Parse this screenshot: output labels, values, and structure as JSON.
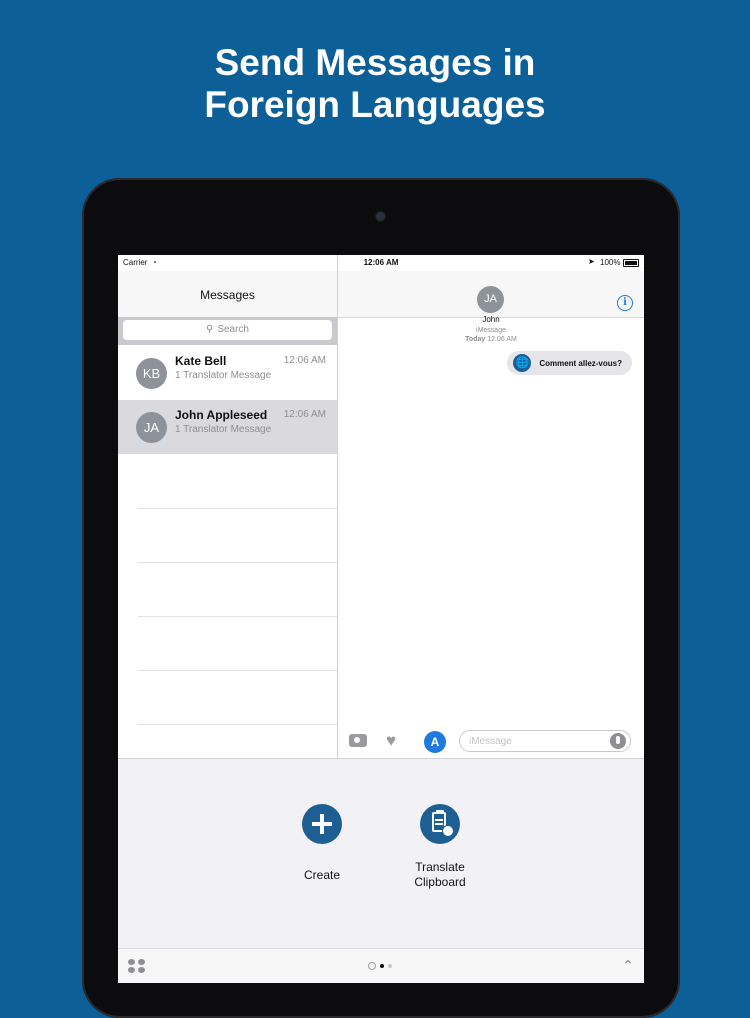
{
  "headline": {
    "line1": "Send Messages in",
    "line2": "Foreign Languages"
  },
  "status": {
    "carrier": "Carrier",
    "time": "12:06 AM",
    "battery": "100%"
  },
  "messages_list": {
    "title": "Messages",
    "search_placeholder": "Search",
    "conversations": [
      {
        "initials": "KB",
        "name": "Kate Bell",
        "preview": "1 Translator Message",
        "time": "12:06 AM",
        "selected": false
      },
      {
        "initials": "JA",
        "name": "John Appleseed",
        "preview": "1 Translator Message",
        "time": "12:06 AM",
        "selected": true
      }
    ]
  },
  "conversation": {
    "contact_initials": "JA",
    "contact_name": "John",
    "service_label": "iMessage",
    "date_label": "Today",
    "date_time": "12:06 AM",
    "message_text": "Comment allez-vous?",
    "input_placeholder": "iMessage"
  },
  "app_drawer": {
    "actions": [
      {
        "label": "Create",
        "icon": "plus-icon"
      },
      {
        "label": "Translate Clipboard",
        "label_line1": "Translate",
        "label_line2": "Clipboard",
        "icon": "clipboard-translate-icon"
      }
    ]
  },
  "colors": {
    "background": "#0d5f97",
    "accent": "#1e5f93",
    "link": "#1f7ae0"
  }
}
